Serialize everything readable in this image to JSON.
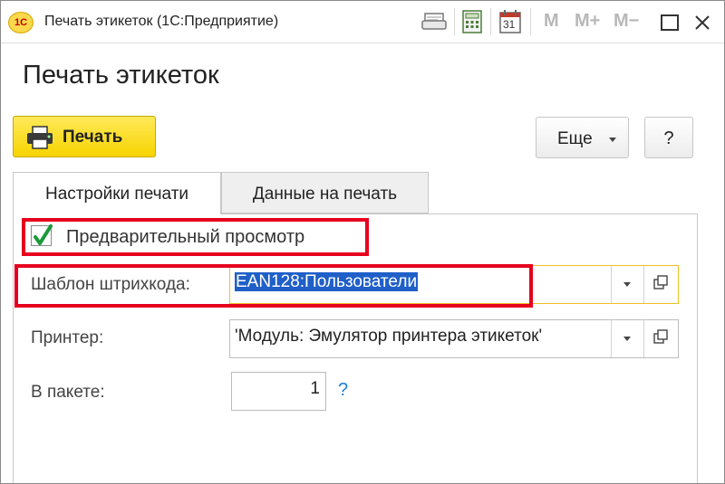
{
  "window": {
    "title": "Печать этикеток  (1С:Предприятие)",
    "logo_text": "1C",
    "toolbar": {
      "m_label": "M",
      "mplus_label": "M+",
      "mminus_label": "M−",
      "calendar_day": "31"
    }
  },
  "form": {
    "title": "Печать этикеток",
    "buttons": {
      "print": "Печать",
      "more": "Еще",
      "help": "?"
    },
    "tabs": [
      {
        "label": "Настройки печати",
        "active": true
      },
      {
        "label": "Данные на печать",
        "active": false
      }
    ],
    "preview_checkbox": {
      "label": "Предварительный просмотр",
      "checked": true
    },
    "barcode_template": {
      "label": "Шаблон штрихкода:",
      "value": "EAN128:Пользователи"
    },
    "printer": {
      "label": "Принтер:",
      "value": "'Модуль: Эмулятор принтера этикеток'"
    },
    "package": {
      "label": "В пакете:",
      "value": "1",
      "help": "?"
    }
  },
  "colors": {
    "accent_yellow": "#f7d400",
    "highlight_red": "#e6001e",
    "selection_blue": "#1f5fc8",
    "check_green": "#1a9a3a"
  }
}
